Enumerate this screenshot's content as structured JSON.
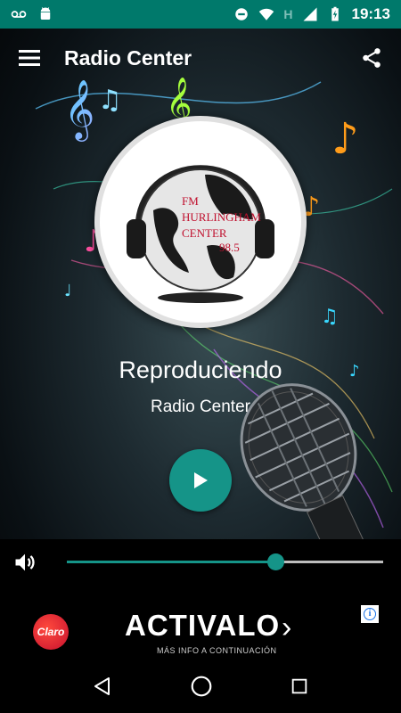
{
  "status_bar": {
    "time": "19:13",
    "icons": [
      "voicemail-icon",
      "android-icon",
      "do-not-disturb-icon",
      "wifi-icon",
      "h-network-icon",
      "signal-icon",
      "battery-charging-icon"
    ],
    "network_label": "H"
  },
  "app": {
    "title": "Radio Center",
    "menu_icon": "hamburger-menu-icon",
    "share_icon": "share-icon"
  },
  "cover": {
    "logo_lines": [
      "FM",
      "HURLINGHAM",
      "CENTER",
      "98.5"
    ]
  },
  "player": {
    "status": "Reproduciendo",
    "station": "Radio Center",
    "play_icon": "play-icon",
    "volume_level": 0.66,
    "accent_color": "#159488"
  },
  "ad": {
    "brand": "Claro",
    "headline": "ACTIVALO",
    "chevron": "›",
    "subtext": "MÁS INFO A CONTINUACIÓN",
    "info_label": "i"
  },
  "nav": {
    "icons": [
      "back-icon",
      "home-icon",
      "recents-icon"
    ]
  }
}
